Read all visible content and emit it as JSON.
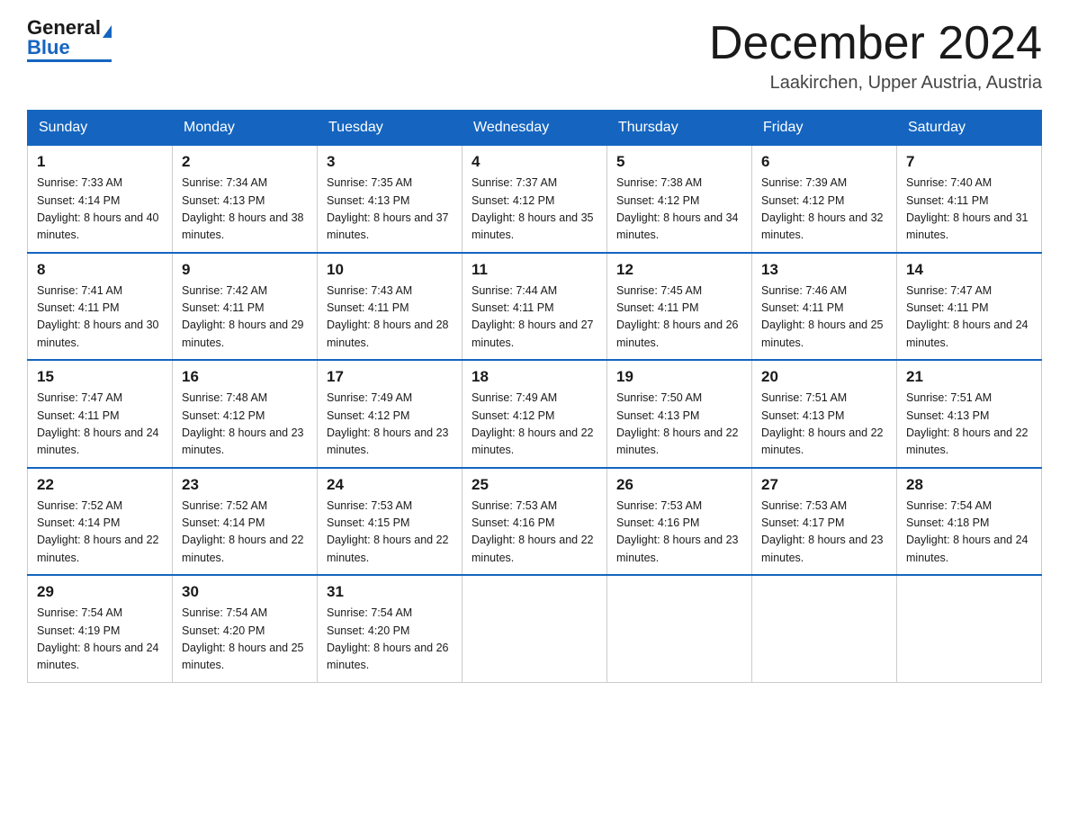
{
  "header": {
    "logo_general": "General",
    "logo_blue": "Blue",
    "month_title": "December 2024",
    "location": "Laakirchen, Upper Austria, Austria"
  },
  "weekdays": [
    "Sunday",
    "Monday",
    "Tuesday",
    "Wednesday",
    "Thursday",
    "Friday",
    "Saturday"
  ],
  "weeks": [
    [
      {
        "day": "1",
        "sunrise": "7:33 AM",
        "sunset": "4:14 PM",
        "daylight": "8 hours and 40 minutes."
      },
      {
        "day": "2",
        "sunrise": "7:34 AM",
        "sunset": "4:13 PM",
        "daylight": "8 hours and 38 minutes."
      },
      {
        "day": "3",
        "sunrise": "7:35 AM",
        "sunset": "4:13 PM",
        "daylight": "8 hours and 37 minutes."
      },
      {
        "day": "4",
        "sunrise": "7:37 AM",
        "sunset": "4:12 PM",
        "daylight": "8 hours and 35 minutes."
      },
      {
        "day": "5",
        "sunrise": "7:38 AM",
        "sunset": "4:12 PM",
        "daylight": "8 hours and 34 minutes."
      },
      {
        "day": "6",
        "sunrise": "7:39 AM",
        "sunset": "4:12 PM",
        "daylight": "8 hours and 32 minutes."
      },
      {
        "day": "7",
        "sunrise": "7:40 AM",
        "sunset": "4:11 PM",
        "daylight": "8 hours and 31 minutes."
      }
    ],
    [
      {
        "day": "8",
        "sunrise": "7:41 AM",
        "sunset": "4:11 PM",
        "daylight": "8 hours and 30 minutes."
      },
      {
        "day": "9",
        "sunrise": "7:42 AM",
        "sunset": "4:11 PM",
        "daylight": "8 hours and 29 minutes."
      },
      {
        "day": "10",
        "sunrise": "7:43 AM",
        "sunset": "4:11 PM",
        "daylight": "8 hours and 28 minutes."
      },
      {
        "day": "11",
        "sunrise": "7:44 AM",
        "sunset": "4:11 PM",
        "daylight": "8 hours and 27 minutes."
      },
      {
        "day": "12",
        "sunrise": "7:45 AM",
        "sunset": "4:11 PM",
        "daylight": "8 hours and 26 minutes."
      },
      {
        "day": "13",
        "sunrise": "7:46 AM",
        "sunset": "4:11 PM",
        "daylight": "8 hours and 25 minutes."
      },
      {
        "day": "14",
        "sunrise": "7:47 AM",
        "sunset": "4:11 PM",
        "daylight": "8 hours and 24 minutes."
      }
    ],
    [
      {
        "day": "15",
        "sunrise": "7:47 AM",
        "sunset": "4:11 PM",
        "daylight": "8 hours and 24 minutes."
      },
      {
        "day": "16",
        "sunrise": "7:48 AM",
        "sunset": "4:12 PM",
        "daylight": "8 hours and 23 minutes."
      },
      {
        "day": "17",
        "sunrise": "7:49 AM",
        "sunset": "4:12 PM",
        "daylight": "8 hours and 23 minutes."
      },
      {
        "day": "18",
        "sunrise": "7:49 AM",
        "sunset": "4:12 PM",
        "daylight": "8 hours and 22 minutes."
      },
      {
        "day": "19",
        "sunrise": "7:50 AM",
        "sunset": "4:13 PM",
        "daylight": "8 hours and 22 minutes."
      },
      {
        "day": "20",
        "sunrise": "7:51 AM",
        "sunset": "4:13 PM",
        "daylight": "8 hours and 22 minutes."
      },
      {
        "day": "21",
        "sunrise": "7:51 AM",
        "sunset": "4:13 PM",
        "daylight": "8 hours and 22 minutes."
      }
    ],
    [
      {
        "day": "22",
        "sunrise": "7:52 AM",
        "sunset": "4:14 PM",
        "daylight": "8 hours and 22 minutes."
      },
      {
        "day": "23",
        "sunrise": "7:52 AM",
        "sunset": "4:14 PM",
        "daylight": "8 hours and 22 minutes."
      },
      {
        "day": "24",
        "sunrise": "7:53 AM",
        "sunset": "4:15 PM",
        "daylight": "8 hours and 22 minutes."
      },
      {
        "day": "25",
        "sunrise": "7:53 AM",
        "sunset": "4:16 PM",
        "daylight": "8 hours and 22 minutes."
      },
      {
        "day": "26",
        "sunrise": "7:53 AM",
        "sunset": "4:16 PM",
        "daylight": "8 hours and 23 minutes."
      },
      {
        "day": "27",
        "sunrise": "7:53 AM",
        "sunset": "4:17 PM",
        "daylight": "8 hours and 23 minutes."
      },
      {
        "day": "28",
        "sunrise": "7:54 AM",
        "sunset": "4:18 PM",
        "daylight": "8 hours and 24 minutes."
      }
    ],
    [
      {
        "day": "29",
        "sunrise": "7:54 AM",
        "sunset": "4:19 PM",
        "daylight": "8 hours and 24 minutes."
      },
      {
        "day": "30",
        "sunrise": "7:54 AM",
        "sunset": "4:20 PM",
        "daylight": "8 hours and 25 minutes."
      },
      {
        "day": "31",
        "sunrise": "7:54 AM",
        "sunset": "4:20 PM",
        "daylight": "8 hours and 26 minutes."
      },
      null,
      null,
      null,
      null
    ]
  ]
}
